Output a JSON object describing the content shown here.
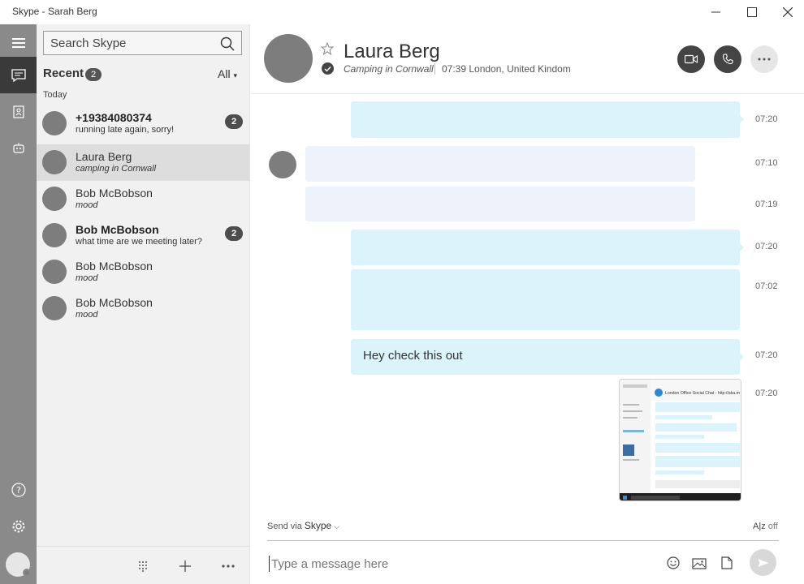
{
  "window": {
    "title": "Skype - Sarah Berg"
  },
  "sidebar": {
    "search_placeholder": "Search Skype",
    "recent_label": "Recent",
    "recent_count": "2",
    "filter_label": "All",
    "section_today": "Today",
    "contacts": [
      {
        "name": "+19384080374",
        "status": "running late again, sorry!",
        "badge": "2",
        "bold": true,
        "italic": false,
        "selected": false
      },
      {
        "name": "Laura Berg",
        "status": "camping in Cornwall",
        "badge": "",
        "bold": false,
        "italic": true,
        "selected": true
      },
      {
        "name": "Bob McBobson",
        "status": "mood",
        "badge": "",
        "bold": false,
        "italic": true,
        "selected": false
      },
      {
        "name": "Bob McBobson",
        "status": "what time are we meeting later?",
        "badge": "2",
        "bold": true,
        "italic": false,
        "selected": false
      },
      {
        "name": "Bob McBobson",
        "status": "mood",
        "badge": "",
        "bold": false,
        "italic": true,
        "selected": false
      },
      {
        "name": "Bob McBobson",
        "status": "mood",
        "badge": "",
        "bold": false,
        "italic": true,
        "selected": false
      }
    ]
  },
  "chat": {
    "header": {
      "name": "Laura Berg",
      "mood": "Camping in Cornwall",
      "local_time": "07:39 London, United Kindom"
    },
    "messages": [
      {
        "direction": "out",
        "text": "",
        "time": "07:20"
      },
      {
        "direction": "in",
        "text": "",
        "time": "07:10"
      },
      {
        "direction": "in",
        "text": "",
        "time": "07:19"
      },
      {
        "direction": "out",
        "text": "",
        "time": "07:20"
      },
      {
        "direction": "out",
        "text": "",
        "time": "07:02"
      },
      {
        "direction": "out",
        "text": "Hey check this out",
        "time": "07:20"
      },
      {
        "direction": "out",
        "text": "",
        "time": "07:20",
        "attachment": "screenshot"
      }
    ],
    "screenshot": {
      "title": "London Office Social Chat - http://aka.m"
    },
    "compose": {
      "send_via_label": "Send via",
      "send_via_value": "Skype",
      "spell_label": "off",
      "placeholder": "Type a message here"
    }
  },
  "icons": {
    "menu": "hamburger-icon",
    "chats": "chat-icon",
    "contacts": "contacts-icon",
    "bots": "bot-icon",
    "help": "help-icon",
    "settings": "gear-icon",
    "search": "search-icon",
    "favorite": "star-icon",
    "video": "video-call-icon",
    "call": "phone-icon",
    "more": "more-icon",
    "dialpad": "dialpad-icon",
    "add": "plus-icon",
    "emoji": "emoji-icon",
    "image": "image-icon",
    "file": "file-icon",
    "send": "send-icon"
  },
  "colors": {
    "accent_out": "#dbf3fa",
    "accent_in": "#eef3fb",
    "rail": "#8a8a8a",
    "rail_active": "#3a3a3a"
  }
}
